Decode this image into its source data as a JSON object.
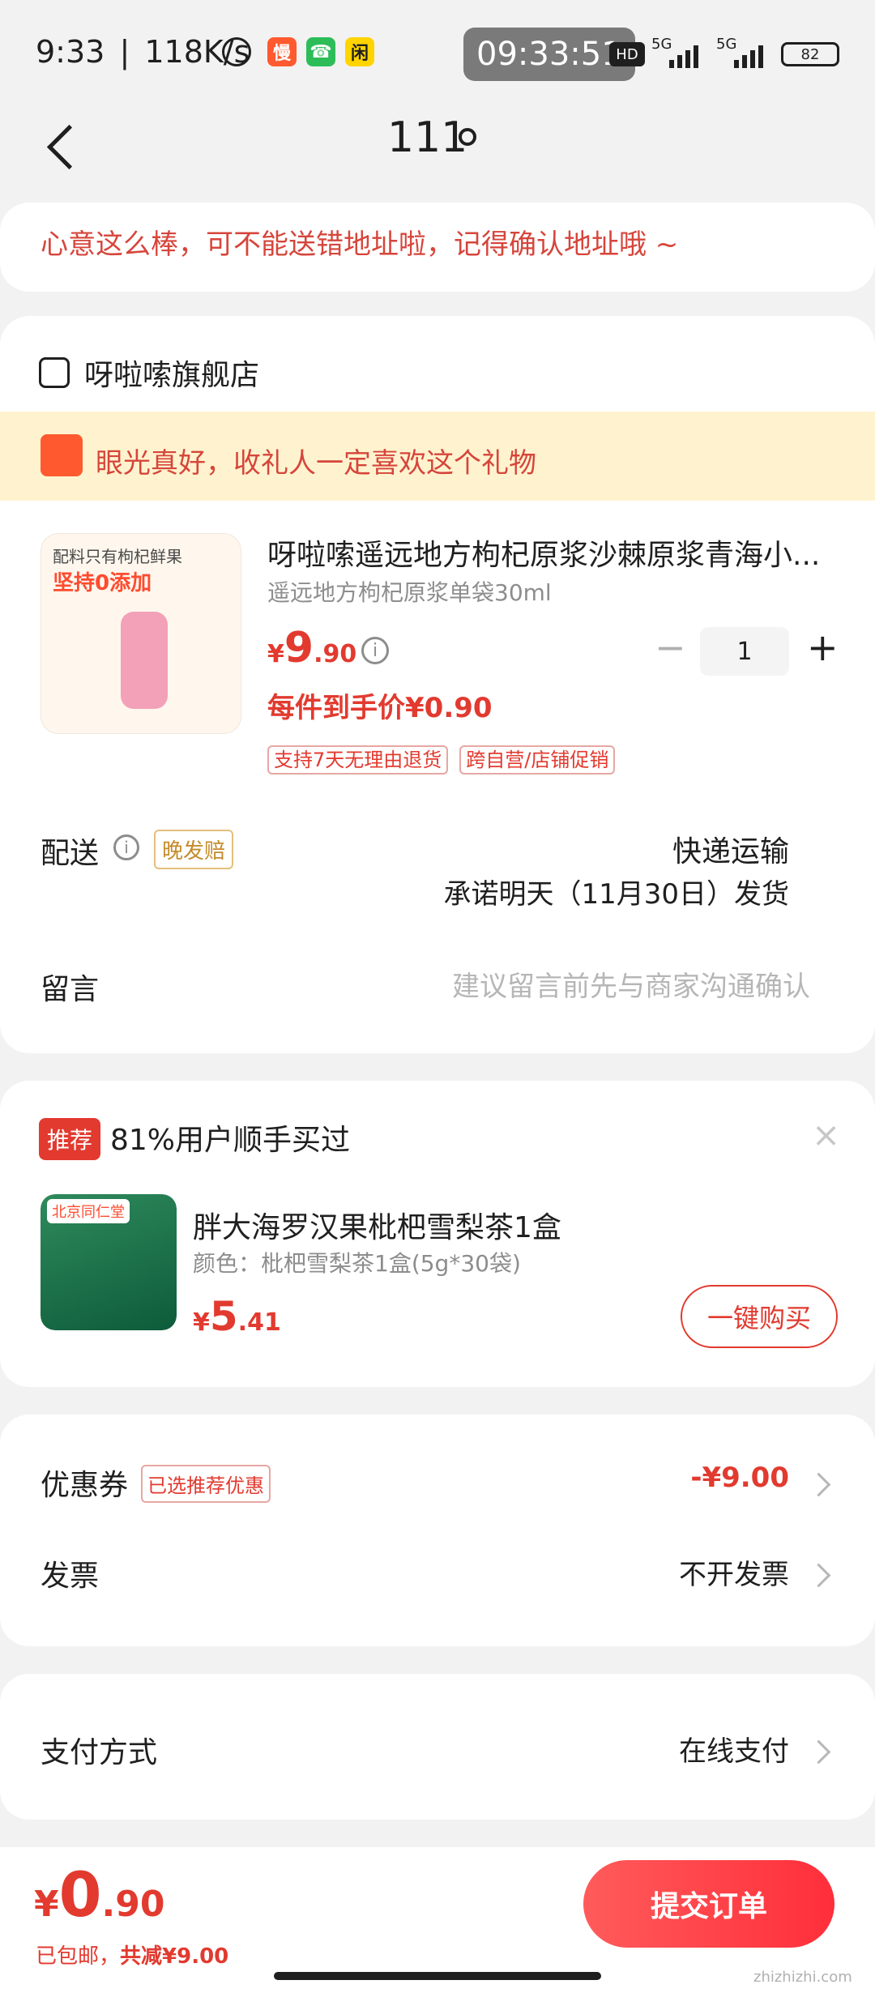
{
  "status_bar": {
    "time": "9:33",
    "speed": "118K/s",
    "center_time": "09:33:51",
    "hd": "HD",
    "net1": "5G",
    "net2": "5G",
    "battery": "82"
  },
  "header": {
    "title": "111"
  },
  "notice": {
    "text": "心意这么棒，可不能送错地址啦，记得确认地址哦 ~"
  },
  "shop": {
    "name": "呀啦嗦旗舰店",
    "gift_banner": "眼光真好，收礼人一定喜欢这个礼物"
  },
  "product": {
    "img_title": "配料只有枸杞鲜果",
    "img_headline": "坚持0添加",
    "title": "呀啦嗦遥远地方枸杞原浆沙棘原浆青海小...",
    "spec": "遥远地方枸杞原浆单袋30ml",
    "price_symbol": "¥",
    "price_int": "9",
    "price_dec": ".90",
    "quantity": "1",
    "per_item_price": "每件到手价¥0.90",
    "tags": [
      "支持7天无理由退货",
      "跨自营/店铺促销"
    ]
  },
  "delivery": {
    "label": "配送",
    "tag": "晚发赔",
    "method": "快递运输",
    "promise": "承诺明天（11月30日）发货"
  },
  "message": {
    "label": "留言",
    "placeholder": "建议留言前先与商家沟通确认"
  },
  "recommend": {
    "badge": "推荐",
    "title": "81%用户顺手买过",
    "product_title": "胖大海罗汉果枇杷雪梨茶1盒",
    "spec": "颜色：枇杷雪梨茶1盒(5g*30袋)",
    "price_symbol": "¥",
    "price_int": "5",
    "price_dec": ".41",
    "buy_label": "一键购买",
    "img_brand": "北京同仁堂"
  },
  "coupon": {
    "label": "优惠券",
    "tag": "已选推荐优惠",
    "value": "-¥9.00"
  },
  "invoice": {
    "label": "发票",
    "value": "不开发票"
  },
  "payment": {
    "label": "支付方式",
    "value": "在线支付"
  },
  "footer": {
    "price_symbol": "¥",
    "price_int": "0",
    "price_dec": ".90",
    "shipping": "已包邮，",
    "discount": "共减¥9.00",
    "submit": "提交订单"
  },
  "watermark": {
    "text": "zhizhizhi.com"
  },
  "colors": {
    "accent": "#e23a2f",
    "background": "#f2f2f2",
    "gift_banner_bg": "#fff3cf"
  }
}
